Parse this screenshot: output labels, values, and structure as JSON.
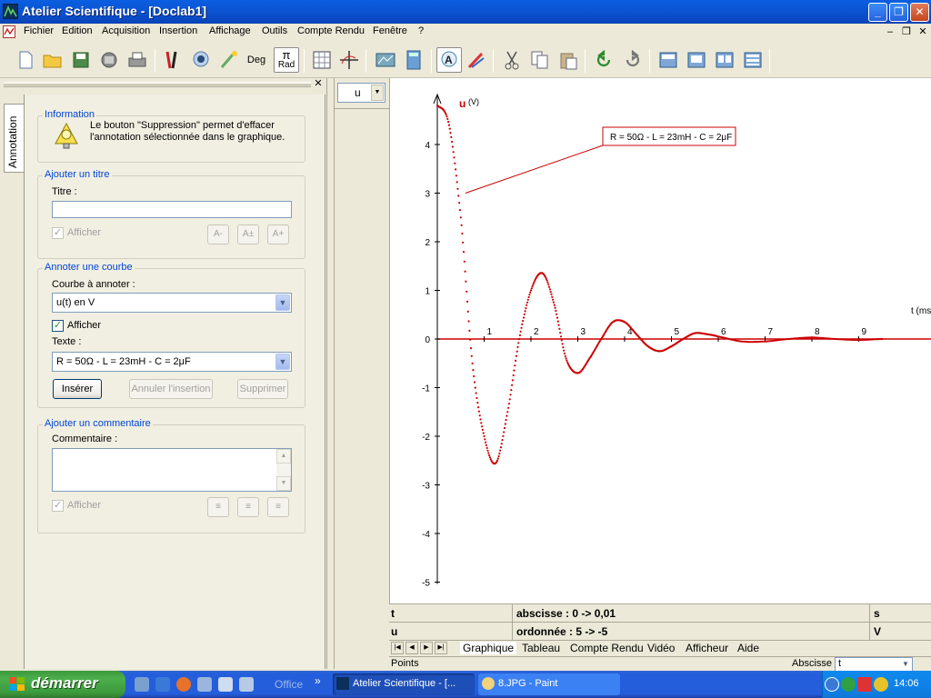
{
  "window": {
    "title": "Atelier Scientifique - [Doclab1]"
  },
  "menu": {
    "items": [
      "Fichier",
      "Edition",
      "Acquisition",
      "Insertion",
      "Affichage",
      "Outils",
      "Compte Rendu",
      "Fenêtre",
      "?"
    ]
  },
  "toolbar": {
    "deg_label": "Deg",
    "pi_symbol": "π",
    "rad_label": "Rad",
    "icons": [
      "new-icon",
      "open-icon",
      "save-icon",
      "save-all-icon",
      "print-icon",
      "probes-icon",
      "webcam-icon",
      "calibrate-icon",
      "angle-unit-icon",
      "grid-icon",
      "axes-icon",
      "modeling-icon",
      "calculator-icon",
      "annotation-icon",
      "pen-icon",
      "cut-icon",
      "copy-icon",
      "paste-icon",
      "undo-icon",
      "redo-icon",
      "view1-icon",
      "view2-icon",
      "view3-icon",
      "view4-icon"
    ]
  },
  "side_panel": {
    "tab_label": "Annotation",
    "info_group": {
      "title": "Information",
      "text_line1": "Le bouton \"Suppression\" permet d'effacer",
      "text_line2": "l'annotation sélectionnée dans le graphique."
    },
    "title_group": {
      "title": "Ajouter un titre",
      "field_label": "Titre :",
      "field_value": "",
      "show_label": "Afficher",
      "show_checked": true
    },
    "curve_group": {
      "title": "Annoter une courbe",
      "curve_label": "Courbe à annoter :",
      "curve_value": "u(t) en V",
      "show_label": "Afficher",
      "show_checked": true,
      "text_label": "Texte :",
      "text_value": "R = 50Ω - L = 23mH - C = 2μF",
      "insert_button": "Insérer",
      "cancel_button": "Annuler l'insertion",
      "delete_button": "Supprimer"
    },
    "comment_group": {
      "title": "Ajouter un commentaire",
      "field_label": "Commentaire :",
      "field_value": "",
      "show_label": "Afficher",
      "show_checked": true
    }
  },
  "series_selector": {
    "value": "u"
  },
  "graph": {
    "annotation_text": "R = 50Ω - L = 23mH - C = 2μF",
    "y_var": "u",
    "y_unit": "(V)",
    "x_label": "t (ms)"
  },
  "chart_data": {
    "type": "scatter",
    "title": "",
    "series": [
      {
        "name": "u",
        "description": "damped oscillation of u(t) in an RLC circuit",
        "color": "#CC0000",
        "x": [
          0,
          0.25,
          0.5,
          0.75,
          1.0,
          1.25,
          1.5,
          1.75,
          2.0,
          2.25,
          2.5,
          2.75,
          3.0,
          3.25,
          3.5,
          3.75,
          4.0,
          4.25,
          4.5,
          4.75,
          5.0,
          5.25,
          5.5,
          5.75,
          6.0,
          6.5,
          7.0,
          7.5,
          8.0,
          8.5,
          9.0,
          9.5
        ],
        "y": [
          4.8,
          4.4,
          2.5,
          -0.5,
          -2.0,
          -2.55,
          -1.5,
          0.0,
          1.0,
          1.35,
          0.7,
          -0.4,
          -0.7,
          -0.4,
          0.0,
          0.35,
          0.35,
          0.1,
          -0.15,
          -0.25,
          -0.15,
          0.0,
          0.12,
          0.1,
          0.05,
          -0.05,
          -0.05,
          0.0,
          0.03,
          0.0,
          -0.02,
          0.0
        ]
      }
    ],
    "xlabel": "t (ms)",
    "ylabel": "u (V)",
    "xlim": [
      0,
      10
    ],
    "ylim": [
      -5,
      5
    ],
    "x_ticks": [
      "1",
      "2",
      "3",
      "4",
      "5",
      "6",
      "7",
      "8",
      "9"
    ],
    "y_ticks": [
      "4",
      "3",
      "2",
      "1",
      "0",
      "-1",
      "-2",
      "-3",
      "-4",
      "-5"
    ],
    "grid": false,
    "legend": "none"
  },
  "info_rows": {
    "row1": {
      "var": "t",
      "range": "abscisse : 0 -> 0,01",
      "unit": "s"
    },
    "row2": {
      "var": "u",
      "range": "ordonnée : 5 -> -5",
      "unit": "V"
    }
  },
  "tabs": [
    "Graphique",
    "Tableau",
    "Compte Rendu",
    "Vidéo",
    "Afficheur",
    "Aide"
  ],
  "active_tab": "Graphique",
  "status_bar": {
    "left": "Points",
    "abscisse_label": "Abscisse",
    "abscisse_value": "t"
  },
  "taskbar": {
    "start_label": "démarrer",
    "quicklaunch_label": "Office",
    "overflow": "»",
    "tasks": [
      {
        "label": "Atelier Scientifique - [...",
        "active": true
      },
      {
        "label": "8.JPG - Paint",
        "active": false
      }
    ],
    "clock": "14:06"
  },
  "colors": {
    "curve": "#CC0000",
    "group_title": "#0046D5",
    "xp_blue": "#0A5FE0"
  }
}
